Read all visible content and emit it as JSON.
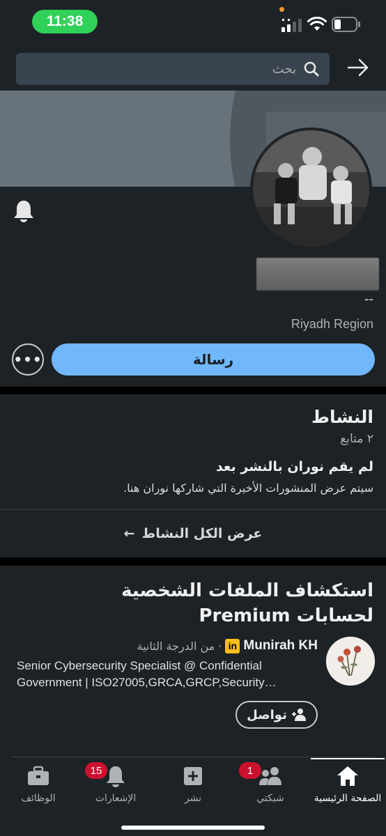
{
  "status_bar": {
    "time": "11:38"
  },
  "header": {
    "search_placeholder": "بحث"
  },
  "profile": {
    "headline": "--",
    "location": "Riyadh Region",
    "message_button": "رسالة",
    "more_button": "•••"
  },
  "activity": {
    "title": "النشاط",
    "followers": "٢ متابع",
    "empty_title": "لم يقم نوران بالنشر بعد",
    "empty_subtitle": "سيتم عرض المنشورات الأخيرة التي شاركها نوران هنا.",
    "show_all": "عرض الكل النشاط",
    "show_all_arrow": "←"
  },
  "explore": {
    "title": "استكشاف الملفات الشخصية لحسابات Premium",
    "recommendations": [
      {
        "name": "Munirah KH",
        "badge": "in",
        "degree": "· من الدرجة الثانية",
        "headline": "Senior Cybersecurity Specialist @ Confidential Government | ISO27005,GRCA,GRCP,Security…",
        "connect_label": "تواصل"
      }
    ]
  },
  "bottom_nav": {
    "items": [
      {
        "label": "الصفحة الرئيسية",
        "icon": "home-icon",
        "active": true
      },
      {
        "label": "شبكتي",
        "icon": "network-icon",
        "badge": "1"
      },
      {
        "label": "نشر",
        "icon": "post-icon"
      },
      {
        "label": "الإشعارات",
        "icon": "bell-icon",
        "badge": "15"
      },
      {
        "label": "الوظائف",
        "icon": "briefcase-icon"
      }
    ]
  },
  "colors": {
    "background": "#1d2226",
    "primary_button": "#71b7fb",
    "badge": "#cb112d",
    "time_pill": "#2fd158",
    "premium_badge": "#ffbe1a"
  }
}
